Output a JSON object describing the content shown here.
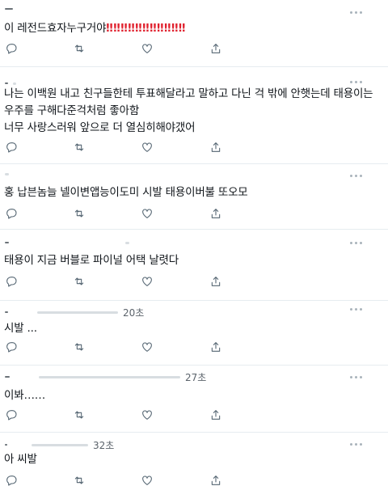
{
  "tweets": [
    {
      "text": "이 레전드효자누구거야",
      "emphasis": "‼‼‼‼‼‼‼‼‼‼‼",
      "time": ""
    },
    {
      "lines": [
        "나는 이백원 내고 친구들한테 투표해달라고 말하고 다닌 걱 밖에 안햇는데 태용이는",
        "우주를 구해다준걱처럼 좋아함",
        "너무 사랑스러워 앞으로 더 열심히해야갰어"
      ],
      "time": ""
    },
    {
      "text": "홍 납븐놈늘 넬이변앱능이도미 시발 태용이버불 또오모",
      "time": ""
    },
    {
      "text": "태용이 지금 버블로 파이널 어택 날렷다",
      "time": ""
    },
    {
      "text": "시발 ...",
      "time": "20초"
    },
    {
      "text": "이봐……",
      "time": "27초"
    },
    {
      "text": "아 씨발",
      "time": "32초"
    }
  ],
  "actions": {
    "reply": "reply-icon",
    "retweet": "retweet-icon",
    "like": "heart-icon",
    "share": "share-icon"
  },
  "colors": {
    "text": "#0f1419",
    "icon": "#536471",
    "divider": "#e6ecf0",
    "emphasis": "#e0212e"
  }
}
